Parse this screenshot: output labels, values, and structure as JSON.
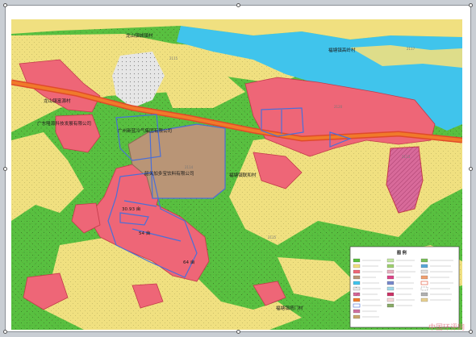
{
  "map": {
    "labels": {
      "village_top": "龙山镇城镇村",
      "village_top_right": "福塘镇高岭村",
      "village_left": "龙山镇富源村",
      "company_1": "广东隆源科技发展有限公司",
      "company_2": "广州新蓝冷气集团有限公司",
      "company_3": "韶关加多宝饮料有限公司",
      "village_center": "福塘镇联和村",
      "village_bottom": "福塘镇塔门村",
      "parcel_1": "30.93 亩",
      "parcel_2": "54 亩",
      "parcel_3": "64 亩"
    },
    "zone_codes": [
      "2115",
      "2120",
      "2114",
      "2113",
      "2117",
      "2125"
    ],
    "legend": {
      "title": "图 例"
    }
  },
  "watermark": "中国环评网",
  "colors": {
    "river": "#40c4ec",
    "forest": "#58c040",
    "farmland": "#f0e080",
    "construction": "#ee6677",
    "industrial": "#b99576",
    "road": "#f07a2a",
    "boundary": "#4a6fd8"
  }
}
